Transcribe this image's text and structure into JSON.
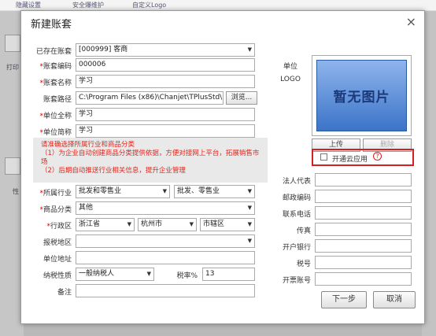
{
  "background": {
    "tabs": [
      "隐藏设置",
      "安全爆维护",
      "自定义Logo"
    ],
    "left_fragments": [
      "打印",
      "性"
    ]
  },
  "dialog": {
    "title": "新建账套",
    "close": "×"
  },
  "form": {
    "existing_account": {
      "label": "已存在账套",
      "value": "[000999] 客商"
    },
    "account_code": {
      "label": "*账套编码",
      "value": "000006"
    },
    "account_name": {
      "label": "*账套名称",
      "value": "学习"
    },
    "account_path": {
      "label": "账套路径",
      "value": "C:\\Program Files (x86)\\Chanjet\\TPlusStd\\DBServer",
      "browse": "浏览..."
    },
    "company_full": {
      "label": "*单位全称",
      "value": "学习"
    },
    "company_short": {
      "label": "*单位简称",
      "value": "学习"
    },
    "notice": [
      "请准确选择所属行业和商品分类",
      "（1）为企业自动创建商品分类提供依据，方便对接网上平台，拓展销售市场",
      "（2）后期自动推送行业相关信息，提升企业管理"
    ],
    "industry": {
      "label": "*所属行业",
      "value1": "批发和零售业",
      "value2": "批发、零售业"
    },
    "goods_category": {
      "label": "*商品分类",
      "value": "其他"
    },
    "region": {
      "label": "*行政区",
      "province": "浙江省",
      "city": "杭州市",
      "district": "市辖区"
    },
    "tax_region": {
      "label": "报税地区",
      "value": ""
    },
    "address": {
      "label": "单位地址",
      "value": ""
    },
    "taxpayer_type": {
      "label": "纳税性质",
      "value": "一般纳税人"
    },
    "tax_rate": {
      "label": "税率%",
      "value": "13"
    },
    "remark": {
      "label": "备注",
      "value": ""
    }
  },
  "logo": {
    "label_line1": "单位",
    "label_line2": "LOGO",
    "placeholder": "暂无图片",
    "upload": "上传",
    "delete": "删除"
  },
  "cloud": {
    "label": "开通云应用",
    "help": "?",
    "checked": false
  },
  "right_fields": {
    "legal_rep": "法人代表",
    "postcode": "邮政编码",
    "phone": "联系电话",
    "fax": "传真",
    "bank": "开户银行",
    "tax_no": "税号",
    "bank_account": "开票账号"
  },
  "buttons": {
    "next": "下一步",
    "cancel": "取消"
  }
}
